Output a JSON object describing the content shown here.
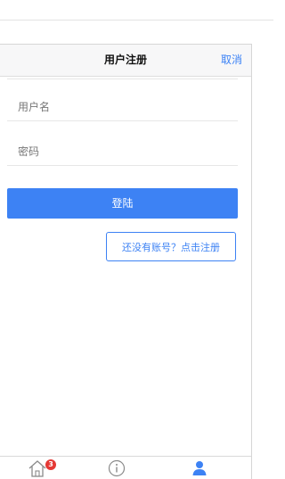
{
  "navbar": {
    "title": "用户注册",
    "cancel_label": "取消"
  },
  "form": {
    "username_placeholder": "用户名",
    "password_placeholder": "密码",
    "login_label": "登陆",
    "register_label": "还没有账号？点击注册"
  },
  "tabbar": {
    "tabs": [
      {
        "icon": "home-icon",
        "badge": "3"
      },
      {
        "icon": "info-icon"
      },
      {
        "icon": "user-icon"
      }
    ]
  },
  "colors": {
    "accent": "#3d82f4",
    "badge": "#e53935"
  }
}
